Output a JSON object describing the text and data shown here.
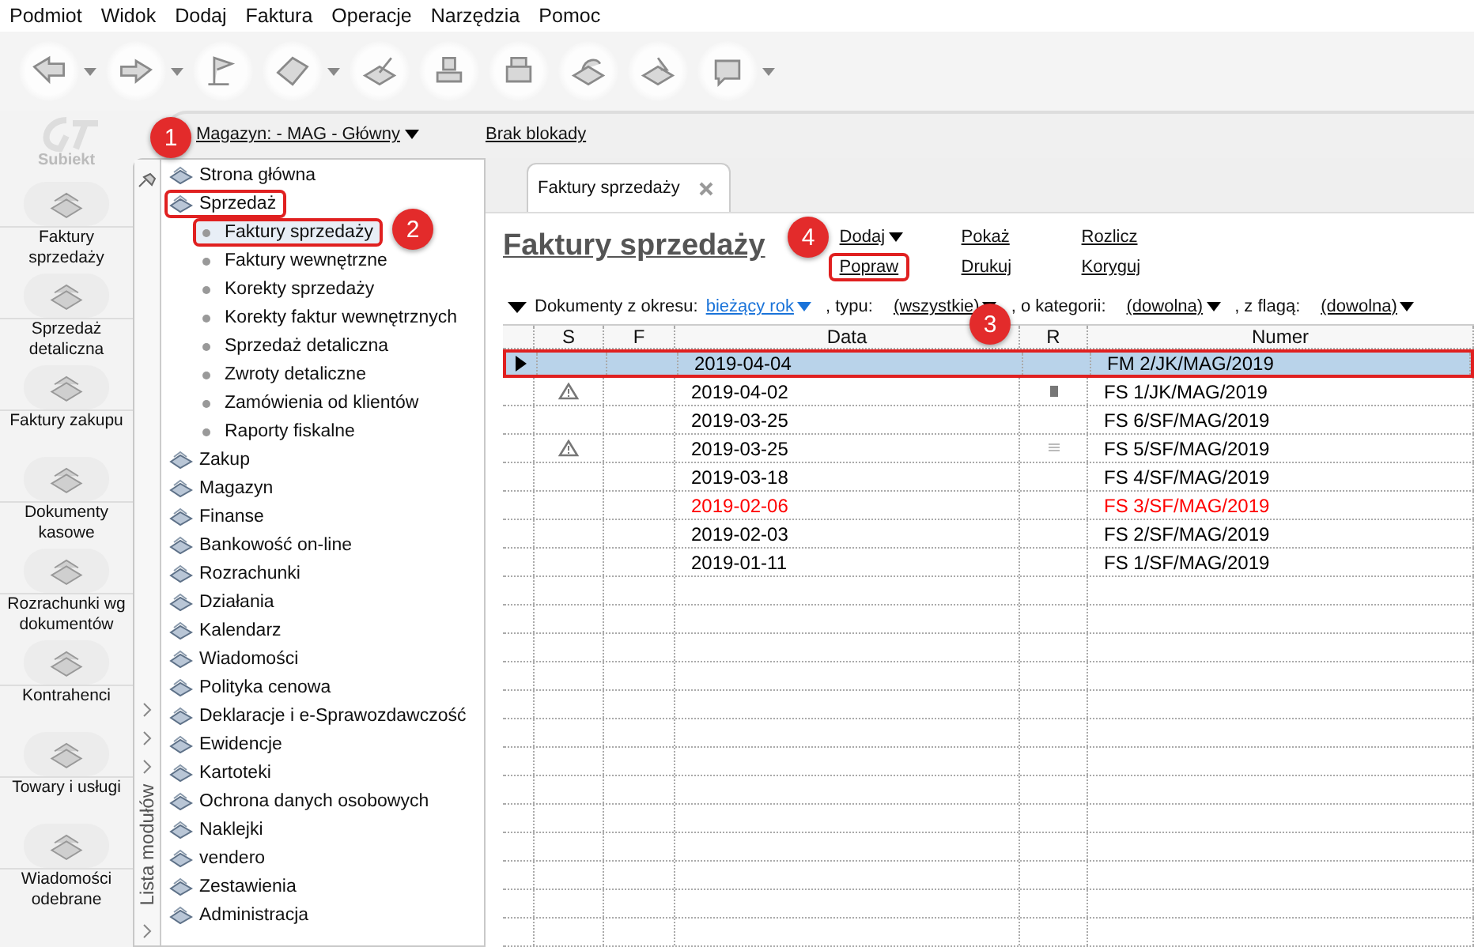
{
  "menu": [
    "Podmiot",
    "Widok",
    "Dodaj",
    "Faktura",
    "Operacje",
    "Narzędzia",
    "Pomoc"
  ],
  "toolbar": [
    {
      "kind": "back",
      "dropdown": true
    },
    {
      "kind": "forward",
      "dropdown": true
    },
    {
      "kind": "flag",
      "dropdown": false
    },
    {
      "kind": "page",
      "dropdown": true
    },
    {
      "kind": "brush",
      "dropdown": false
    },
    {
      "kind": "stamp",
      "dropdown": false
    },
    {
      "kind": "printer",
      "dropdown": false
    },
    {
      "kind": "export",
      "dropdown": false
    },
    {
      "kind": "import",
      "dropdown": false
    },
    {
      "kind": "help",
      "dropdown": true
    }
  ],
  "logo": {
    "text": "Subiekt"
  },
  "shortcuts": [
    {
      "label": "Faktury sprzedaży"
    },
    {
      "label": "Sprzedaż detaliczna"
    },
    {
      "label": "Faktury zakupu"
    },
    {
      "label": "Dokumenty kasowe"
    },
    {
      "label": "Rozrachunki wg dokumentów"
    },
    {
      "label": "Kontrahenci"
    },
    {
      "label": "Towary i usługi"
    },
    {
      "label": "Wiadomości odebrane"
    }
  ],
  "store_bar": {
    "warehouse": "Magazyn: - MAG - Główny",
    "lock": "Brak blokady"
  },
  "modules": {
    "side_label": "Lista modułów",
    "items": [
      {
        "label": "Strona główna",
        "highlighted": false
      },
      {
        "label": "Sprzedaż",
        "highlighted": true,
        "children": [
          {
            "label": "Faktury sprzedaży",
            "selected": true,
            "highlighted": true
          },
          {
            "label": "Faktury wewnętrzne",
            "selected": false,
            "highlighted": false
          },
          {
            "label": "Korekty sprzedaży",
            "selected": false,
            "highlighted": false
          },
          {
            "label": "Korekty faktur wewnętrznych",
            "selected": false,
            "highlighted": false
          },
          {
            "label": "Sprzedaż detaliczna",
            "selected": false,
            "highlighted": false
          },
          {
            "label": "Zwroty detaliczne",
            "selected": false,
            "highlighted": false
          },
          {
            "label": "Zamówienia od klientów",
            "selected": false,
            "highlighted": false
          },
          {
            "label": "Raporty fiskalne",
            "selected": false,
            "highlighted": false
          }
        ]
      },
      {
        "label": "Zakup",
        "highlighted": false
      },
      {
        "label": "Magazyn",
        "highlighted": false
      },
      {
        "label": "Finanse",
        "highlighted": false
      },
      {
        "label": "Bankowość on-line",
        "highlighted": false
      },
      {
        "label": "Rozrachunki",
        "highlighted": false
      },
      {
        "label": "Działania",
        "highlighted": false
      },
      {
        "label": "Kalendarz",
        "highlighted": false
      },
      {
        "label": "Wiadomości",
        "highlighted": false
      },
      {
        "label": "Polityka cenowa",
        "highlighted": false
      },
      {
        "label": "Deklaracje i e-Sprawozdawczość",
        "highlighted": false
      },
      {
        "label": "Ewidencje",
        "highlighted": false
      },
      {
        "label": "Kartoteki",
        "highlighted": false
      },
      {
        "label": "Ochrona danych osobowych",
        "highlighted": false
      },
      {
        "label": "Naklejki",
        "highlighted": false
      },
      {
        "label": "vendero",
        "highlighted": false
      },
      {
        "label": "Zestawienia",
        "highlighted": false
      },
      {
        "label": "Administracja",
        "highlighted": false
      }
    ]
  },
  "tab": {
    "label": "Faktury sprzedaży"
  },
  "title": "Faktury sprzedaży",
  "actions": [
    {
      "label": "Dodaj",
      "dropdown": true,
      "highlighted": false
    },
    {
      "label": "Pokaż",
      "dropdown": false,
      "highlighted": false
    },
    {
      "label": "Rozlicz",
      "dropdown": false,
      "highlighted": false
    },
    {
      "label": "Popraw",
      "dropdown": false,
      "highlighted": true
    },
    {
      "label": "Drukuj",
      "dropdown": false,
      "highlighted": false
    },
    {
      "label": "Koryguj",
      "dropdown": false,
      "highlighted": false
    }
  ],
  "filter": [
    {
      "kind": "label",
      "text": "Dokumenty z okresu:"
    },
    {
      "kind": "link",
      "text": "bieżący rok"
    },
    {
      "kind": "label",
      "text": ", typu:"
    },
    {
      "kind": "select",
      "text": "(wszystkie)"
    },
    {
      "kind": "label",
      "text": ", o kategorii:"
    },
    {
      "kind": "select",
      "text": "(dowolna)"
    },
    {
      "kind": "label",
      "text": ", z flagą:"
    },
    {
      "kind": "select",
      "text": "(dowolna)"
    }
  ],
  "table": {
    "columns": [
      "S",
      "F",
      "Data",
      "R",
      "Numer"
    ],
    "rows": [
      {
        "selected": true,
        "highlighted": true,
        "warning": false,
        "r_square": false,
        "r_lines": false,
        "color": "#000000",
        "date": "2019-04-04",
        "number": "FM 2/JK/MAG/2019"
      },
      {
        "selected": false,
        "highlighted": false,
        "warning": true,
        "r_square": true,
        "r_lines": false,
        "color": "#000000",
        "date": "2019-04-02",
        "number": "FS 1/JK/MAG/2019"
      },
      {
        "selected": false,
        "highlighted": false,
        "warning": false,
        "r_square": false,
        "r_lines": false,
        "color": "#000000",
        "date": "2019-03-25",
        "number": "FS 6/SF/MAG/2019"
      },
      {
        "selected": false,
        "highlighted": false,
        "warning": true,
        "r_square": false,
        "r_lines": true,
        "color": "#000000",
        "date": "2019-03-25",
        "number": "FS 5/SF/MAG/2019"
      },
      {
        "selected": false,
        "highlighted": false,
        "warning": false,
        "r_square": false,
        "r_lines": false,
        "color": "#000000",
        "date": "2019-03-18",
        "number": "FS 4/SF/MAG/2019"
      },
      {
        "selected": false,
        "highlighted": false,
        "warning": false,
        "r_square": false,
        "r_lines": false,
        "color": "#ff0000",
        "date": "2019-02-06",
        "number": "FS 3/SF/MAG/2019"
      },
      {
        "selected": false,
        "highlighted": false,
        "warning": false,
        "r_square": false,
        "r_lines": false,
        "color": "#000000",
        "date": "2019-02-03",
        "number": "FS 2/SF/MAG/2019"
      },
      {
        "selected": false,
        "highlighted": false,
        "warning": false,
        "r_square": false,
        "r_lines": false,
        "color": "#000000",
        "date": "2019-01-11",
        "number": "FS 1/SF/MAG/2019"
      }
    ]
  },
  "callouts": [
    "1",
    "2",
    "3",
    "4"
  ]
}
